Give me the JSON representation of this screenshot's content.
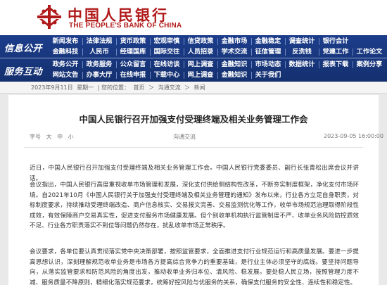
{
  "header": {
    "title_cn": "中国人民银行",
    "title_en": "THE PEOPLE'S BANK OF CHINA",
    "brand_color": "#b11a1a"
  },
  "nav": {
    "sections": [
      "信息公开",
      "服务互动"
    ],
    "row1": [
      [
        "新闻发布",
        "法律法规",
        "货币政策",
        "宏观审慎",
        "信贷政策",
        "金融市场",
        "金融稳定",
        "调查统计",
        "银行会计"
      ],
      [
        "金融科技",
        "人民币",
        "经理国库",
        "国际交往",
        "人员招录",
        "学术交流",
        "征信管理",
        "反洗钱",
        "党建工作",
        "工作论文"
      ]
    ],
    "row2": [
      [
        "政务公开",
        "政务服务",
        "公众留言",
        "在线访谈",
        "网上调查",
        "金融知识",
        "市场动态",
        "数据统计",
        "报表下载",
        "案例分享"
      ],
      [
        "网站文告",
        "办事大厅",
        "在线申报",
        "下载中心",
        "网上调查",
        "金融知识",
        "关于我们"
      ]
    ],
    "bg_color": "#1c3d8b"
  },
  "breadcrumb": {
    "date_text": "2023年9月11日",
    "day_text": "星期一",
    "prefix": "| 您的位置：",
    "items": [
      "首页",
      "沟通交流",
      "新闻"
    ],
    "separator": "＞"
  },
  "article": {
    "title": "中国人民银行召开加强支付受理终端及相关业务管理工作会",
    "font_size_label": "字号",
    "font_sizes": [
      "大",
      "中",
      "小"
    ],
    "source": "沟通交流",
    "date": "2023-09-05  16:00:00",
    "paragraphs": [
      "近日，中国人民银行召开加强支付受理终端及相关业务管理工作会。中国人民银行党委委员、副行长张青松出席会议并讲话。",
      "会议指出，中国人民银行高度重视收单市场管理和发展，深化支付供给侧结构性改革，不断夯实制度框架，净化支付市场环境。自2021年10月《中国人民银行关于加强支付受理终端及相关业务管理的通知》发布以来，行业各方立足自身职责，对标制度要求，持续推动受理终端改造、商户信息核实、交易报文完善、交易监测优化等工作，收单市场规范治理取得阶段性成效，有效保障商户交易真实性，促进支付服务市场健康发展。但个别收单机构执行监管制度不严、收单业务风险防控质效不足、行业各方职责落实不到位等问题仍然存在，扰乱收单市场正常秩序。",
      "会议要求，各单位要认真贯彻落实党中央决策部署，按照监管要求，全面推进支付行业规范运行和高质量发展。要进一步提高思想认识，深刻理解规范收单业务是市场各方提高综合竞争力的重要基础，是行业主体必须坚守的底线。要坚持问题导向，从落实监管要求和防范风险的角度出发，推动收单业务归本位、清风险、稳发展。要处稳人民立场，按照管理力度不减、服务质量不降原则，精细化落实规范要求，统筹好控风险与优服务的关系，确保支付服务的安全性、连续性和稳定性。"
    ]
  }
}
